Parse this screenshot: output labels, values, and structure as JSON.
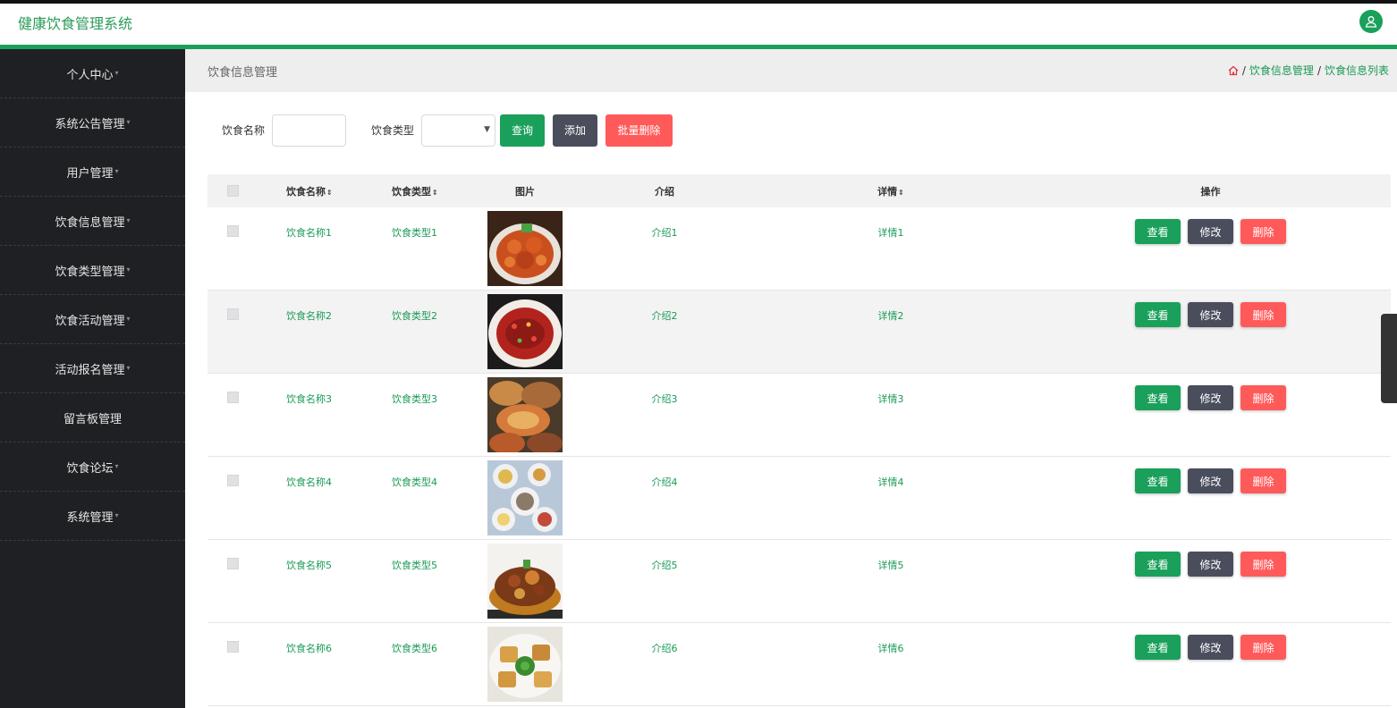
{
  "app": {
    "title": "健康饮食管理系统"
  },
  "sidebar": {
    "items": [
      {
        "label": "个人中心"
      },
      {
        "label": "系统公告管理"
      },
      {
        "label": "用户管理"
      },
      {
        "label": "饮食信息管理"
      },
      {
        "label": "饮食类型管理"
      },
      {
        "label": "饮食活动管理"
      },
      {
        "label": "活动报名管理"
      },
      {
        "label": "留言板管理"
      },
      {
        "label": "饮食论坛"
      },
      {
        "label": "系统管理"
      }
    ]
  },
  "page": {
    "section_title": "饮食信息管理",
    "breadcrumb": [
      "饮食信息管理",
      "饮食信息列表"
    ],
    "breadcrumb_sep": "/"
  },
  "search": {
    "name_label": "饮食名称",
    "name_value": "",
    "type_label": "饮食类型",
    "type_value": "",
    "query_button": "查询",
    "add_button": "添加",
    "batch_delete_button": "批量删除"
  },
  "table": {
    "columns": {
      "name": "饮食名称",
      "type": "饮食类型",
      "image": "图片",
      "intro": "介绍",
      "detail": "详情",
      "ops": "操作"
    },
    "sort_mark": "⇕",
    "view_label": "查看",
    "edit_label": "修改",
    "delete_label": "删除",
    "rows": [
      {
        "name": "饮食名称1",
        "type": "饮食类型1",
        "intro": "介绍1",
        "detail": "详情1"
      },
      {
        "name": "饮食名称2",
        "type": "饮食类型2",
        "intro": "介绍2",
        "detail": "详情2"
      },
      {
        "name": "饮食名称3",
        "type": "饮食类型3",
        "intro": "介绍3",
        "detail": "详情3"
      },
      {
        "name": "饮食名称4",
        "type": "饮食类型4",
        "intro": "介绍4",
        "detail": "详情4"
      },
      {
        "name": "饮食名称5",
        "type": "饮食类型5",
        "intro": "介绍5",
        "detail": "详情5"
      },
      {
        "name": "饮食名称6",
        "type": "饮食类型6",
        "intro": "介绍6",
        "detail": "详情6"
      }
    ]
  },
  "colors": {
    "accent": "#1aa05a",
    "sidebar_bg": "#1f2023",
    "danger": "#ff5a5a",
    "neutral_btn": "#4a4d5c"
  }
}
